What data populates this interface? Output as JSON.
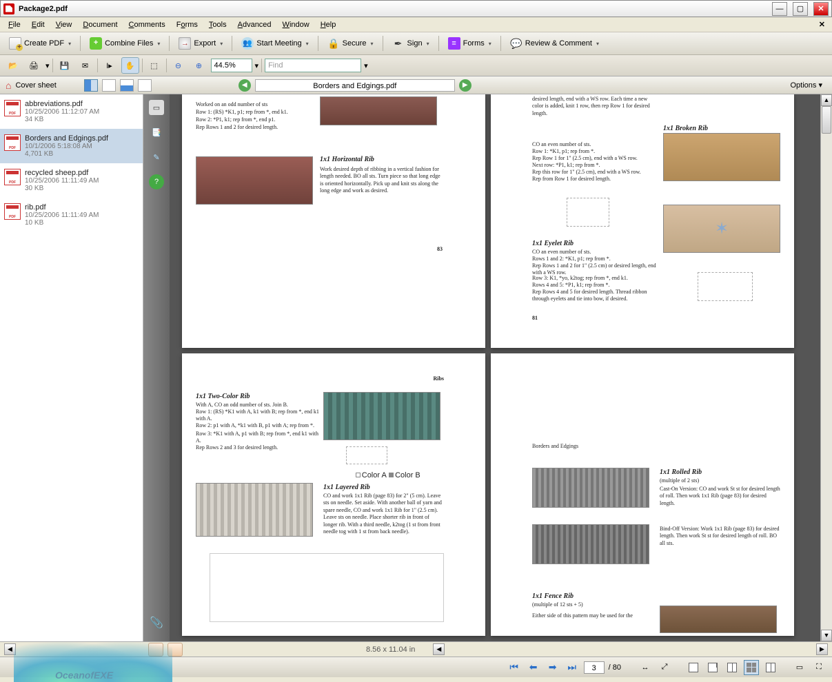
{
  "window": {
    "title": "Package2.pdf"
  },
  "menu": {
    "file": "File",
    "edit": "Edit",
    "view": "View",
    "document": "Document",
    "comments": "Comments",
    "forms": "Forms",
    "tools": "Tools",
    "advanced": "Advanced",
    "window": "Window",
    "help": "Help"
  },
  "toolbar1": {
    "create": "Create PDF",
    "combine": "Combine Files",
    "export": "Export",
    "meeting": "Start Meeting",
    "secure": "Secure",
    "sign": "Sign",
    "forms": "Forms",
    "review": "Review & Comment"
  },
  "toolbar2": {
    "zoom": "44.5%",
    "find_placeholder": "Find"
  },
  "navbar": {
    "cover": "Cover sheet",
    "docname": "Borders and Edgings.pdf",
    "options": "Options"
  },
  "files": [
    {
      "name": "abbreviations.pdf",
      "date": "10/25/2006 11:12:07 AM",
      "size": "34 KB"
    },
    {
      "name": "Borders and Edgings.pdf",
      "date": "10/1/2006 5:18:08 AM",
      "size": "4,701 KB"
    },
    {
      "name": "recycled sheep.pdf",
      "date": "10/25/2006 11:11:49 AM",
      "size": "30 KB"
    },
    {
      "name": "rib.pdf",
      "date": "10/25/2006 11:11:49 AM",
      "size": "10 KB"
    }
  ],
  "doc": {
    "p1": {
      "intro1": "Worked on an odd number of sts",
      "intro2": "Row 1: (RS) *K1, p1; rep from *, end k1.",
      "intro3": "Row 2: *P1, k1; rep from *, end p1.",
      "intro4": "Rep Rows 1 and 2 for desired length.",
      "hrib_title": "1x1   Horizontal   Rib",
      "hrib_body": "Work desired depth of ribbing in a vertical fashion for length needed. BO all sts. Turn piece so that long edge is oriented horizontally. Pick up and knit sts along the long edge and work as desired.",
      "pagenum": "83"
    },
    "p2": {
      "top_body": "desired length, end with a WS row. Each time a new color is added, knit 1 row, then rep Row 1 for desired length.",
      "broken_title": "1x1   Broken   Rib",
      "broken_b1": "CO an even number of sts.",
      "broken_b2": "Row 1: *K1, p1; rep from *.",
      "broken_b3": "Rep Row 1 for 1\" (2.5 cm), end with a WS row.",
      "broken_b4": "Next row: *P1, k1; rep from *.",
      "broken_b5": "Rep this row for 1\" (2.5 cm), end with a WS row.",
      "broken_b6": "Rep from Row 1 for desired length.",
      "eyelet_title": "1x1   Eyelet   Rib",
      "eyelet_b1": "CO an even number of sts.",
      "eyelet_b2": "Rows 1 and 2: *K1, p1; rep from *.",
      "eyelet_b3": "Rep Rows 1 and 2 for 1\" (2.5 cm) or desired length, end with a WS row.",
      "eyelet_b4": "Row 3: K1, *yo, k2tog; rep from *, end k1.",
      "eyelet_b5": "Rows 4 and 5: *P1, k1; rep from *.",
      "eyelet_b6": "Rep Rows 4 and 5 for desired length. Thread ribbon through eyelets and tie into bow, if desired.",
      "pagenum": "81"
    },
    "p3": {
      "header": "Ribs",
      "tc_title": "1x1   Two-Color   Rib",
      "tc_b1": "With A, CO an odd number of sts. Join B.",
      "tc_b2": "Row 1: (RS) *K1 with A, k1 with B; rep from *, end k1 with A.",
      "tc_b3": "Row 2: p1 with A, *k1 with B, p1 with A; rep from *.",
      "tc_b4": "Row 3: *K1 with A, p1 with B; rep from *, end k1 with A.",
      "tc_b5": "Rep Rows 2 and 3 for desired length.",
      "lay_title": "1x1   Layered   Rib",
      "lay_body": "CO and work 1x1 Rib (page 83) for 2\" (5 cm). Leave sts on needle. Set aside. With another ball of yarn and spare needle, CO and work 1x1 Rib for 1\" (2.5 cm). Leave sts on needle. Place shorter rib in front of longer rib. With a third needle, k2tog (1 st from front needle tog with 1 st from back needle).",
      "legend_a": "Color A",
      "legend_b": "Color B"
    },
    "p4": {
      "header": "Borders and Edgings",
      "roll_title": "1x1   Rolled   Rib",
      "roll_sub": "(multiple of 2 sts)",
      "roll_b1": "Cast-On Version: CO and work St st for desired length of roll. Then work 1x1 Rib (page 83) for desired length.",
      "roll_b2": "Bind-Off Version: Work 1x1 Rib (page 83) for desired length. Then work St st for desired length of roll. BO all sts.",
      "fence_title": "1x1   Fence   Rib",
      "fence_sub": "(multiple of 12 sts + 5)",
      "fence_body": "Either side of this pattern may be used for the"
    }
  },
  "status": {
    "dims": "8.56 x 11.04 in",
    "page": "3",
    "total": "/ 80"
  },
  "watermark": "OceanofEXE"
}
